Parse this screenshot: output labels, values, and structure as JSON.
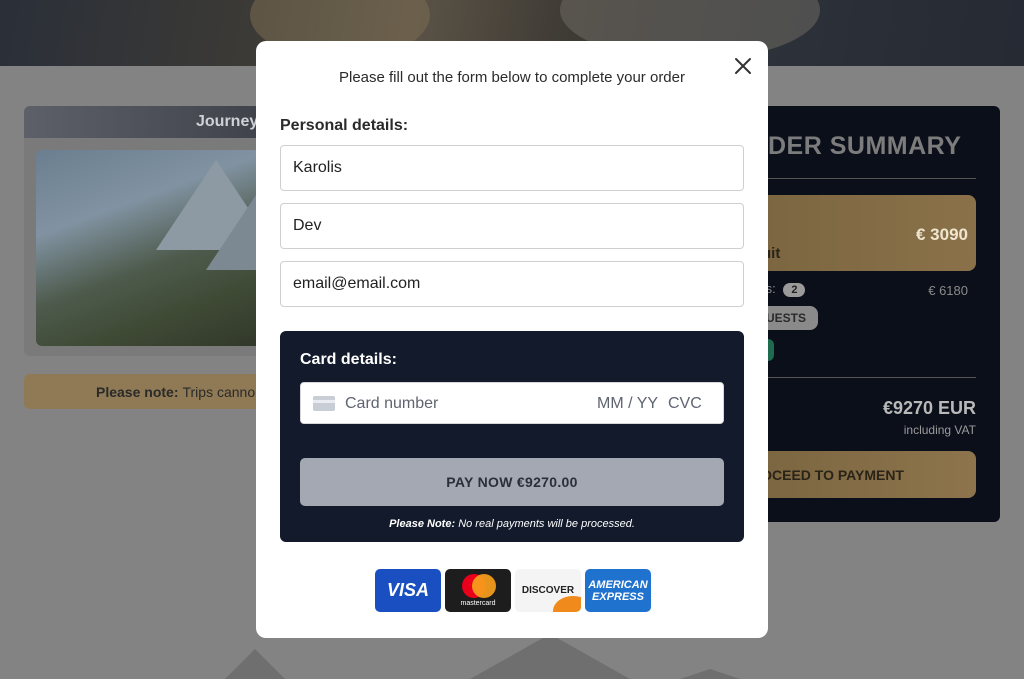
{
  "background": {
    "journey_title": "Journey",
    "note_bold": "Please note:",
    "note_text": "Trips canno",
    "summary": {
      "title": "DER SUMMARY",
      "item_name": "uit",
      "item_price": "€ 3090",
      "participants_label": "ts:",
      "participants_count": "2",
      "participants_amount": "€ 6180",
      "guests_label": "UESTS",
      "total_amount": "€9270 EUR",
      "total_vat": "including VAT",
      "proceed_label": "OCEED TO PAYMENT"
    }
  },
  "modal": {
    "title": "Please fill out the form below to complete your order",
    "personal_label": "Personal details:",
    "first_name": "Karolis",
    "last_name": "Dev",
    "email": "email@email.com",
    "card_label": "Card details:",
    "card_number_placeholder": "Card number",
    "card_expiry_placeholder": "MM / YY",
    "card_cvc_placeholder": "CVC",
    "pay_button": "PAY NOW €9270.00",
    "pay_note_bold": "Please Note:",
    "pay_note_text": "No real payments will be processed.",
    "logos": {
      "visa": "VISA",
      "mastercard": "mastercard",
      "discover": "DISCOVER",
      "amex_line1": "AMERICAN",
      "amex_line2": "EXPRESS"
    },
    "icons": [
      "close-icon",
      "credit-card-icon"
    ]
  },
  "colors": {
    "overlay_gray": "#838383",
    "modal_bg": "#ffffff",
    "card_panel": "#121a2b",
    "pay_button": "#a3a8b3",
    "summary_bg": "#0b0f1a",
    "gold_accent": "#8a7149"
  }
}
